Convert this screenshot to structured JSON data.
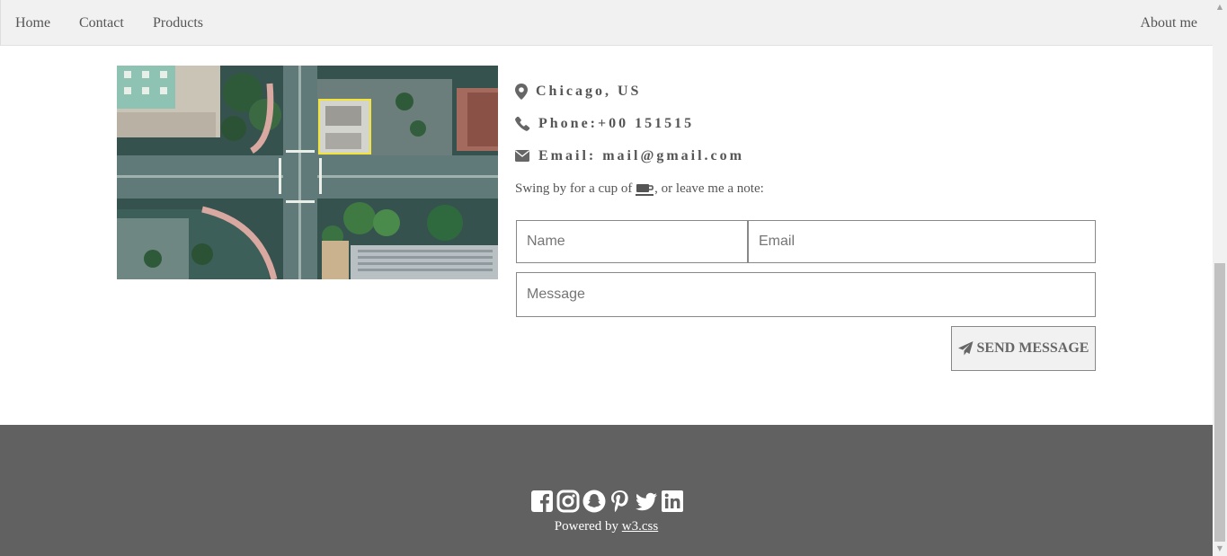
{
  "nav": {
    "items": [
      {
        "label": "Home"
      },
      {
        "label": "Contact"
      },
      {
        "label": "Products"
      }
    ],
    "right_item": {
      "label": "About me"
    }
  },
  "image": {
    "icon": "aerial-city-photo"
  },
  "contact": {
    "location": {
      "icon": "map-marker-icon",
      "text": "Chicago, US"
    },
    "phone": {
      "icon": "phone-icon",
      "text": "Phone:+00 151515"
    },
    "email": {
      "icon": "envelope-icon",
      "text": "Email: mail@gmail.com"
    }
  },
  "note": {
    "prefix": "Swing by for a cup of ",
    "icon": "coffee-icon",
    "suffix": ", or leave me a note:"
  },
  "form": {
    "name_placeholder": "Name",
    "email_placeholder": "Email",
    "message_placeholder": "Message",
    "send_label": "SEND MESSAGE",
    "send_icon": "paper-plane-icon"
  },
  "footer": {
    "social_icons": [
      "facebook-icon",
      "instagram-icon",
      "snapchat-icon",
      "pinterest-icon",
      "twitter-icon",
      "linkedin-icon"
    ],
    "powered_prefix": "Powered by ",
    "powered_link": "w3.css",
    "background": "#616161"
  },
  "colors": {
    "nav_bg": "#f1f1f1",
    "text": "#555555",
    "footer_bg": "#616161"
  }
}
